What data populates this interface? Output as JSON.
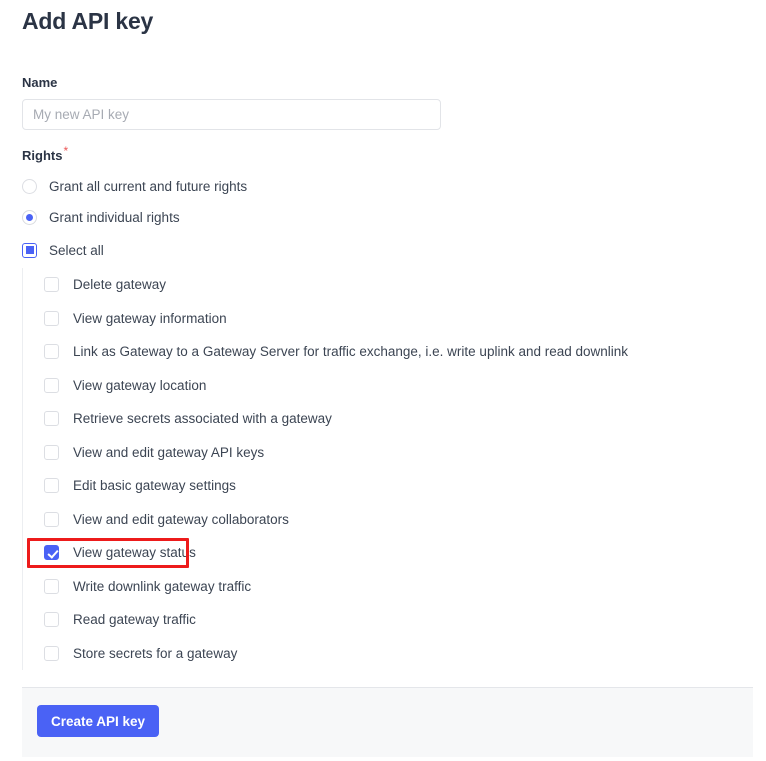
{
  "page": {
    "title": "Add API key"
  },
  "name_field": {
    "label": "Name",
    "value": "",
    "placeholder": "My new API key"
  },
  "rights": {
    "label": "Rights",
    "required_marker": "*",
    "options": [
      {
        "label": "Grant all current and future rights",
        "selected": false
      },
      {
        "label": "Grant individual rights",
        "selected": true
      }
    ],
    "select_all": {
      "label": "Select all",
      "state": "indeterminate"
    },
    "items": [
      {
        "label": "Delete gateway",
        "checked": false
      },
      {
        "label": "View gateway information",
        "checked": false
      },
      {
        "label": "Link as Gateway to a Gateway Server for traffic exchange, i.e. write uplink and read downlink",
        "checked": false
      },
      {
        "label": "View gateway location",
        "checked": false
      },
      {
        "label": "Retrieve secrets associated with a gateway",
        "checked": false
      },
      {
        "label": "View and edit gateway API keys",
        "checked": false
      },
      {
        "label": "Edit basic gateway settings",
        "checked": false
      },
      {
        "label": "View and edit gateway collaborators",
        "checked": false
      },
      {
        "label": "View gateway status",
        "checked": true
      },
      {
        "label": "Write downlink gateway traffic",
        "checked": false
      },
      {
        "label": "Read gateway traffic",
        "checked": false
      },
      {
        "label": "Store secrets for a gateway",
        "checked": false
      }
    ]
  },
  "footer": {
    "submit_label": "Create API key"
  },
  "annotation": {
    "target_label": "View gateway status",
    "color": "#ed1b1b"
  },
  "colors": {
    "accent": "#4a62f5",
    "required": "#eb5757",
    "text": "#2b3445",
    "border": "#dcdee3",
    "footer_bg": "#f7f8f9"
  }
}
